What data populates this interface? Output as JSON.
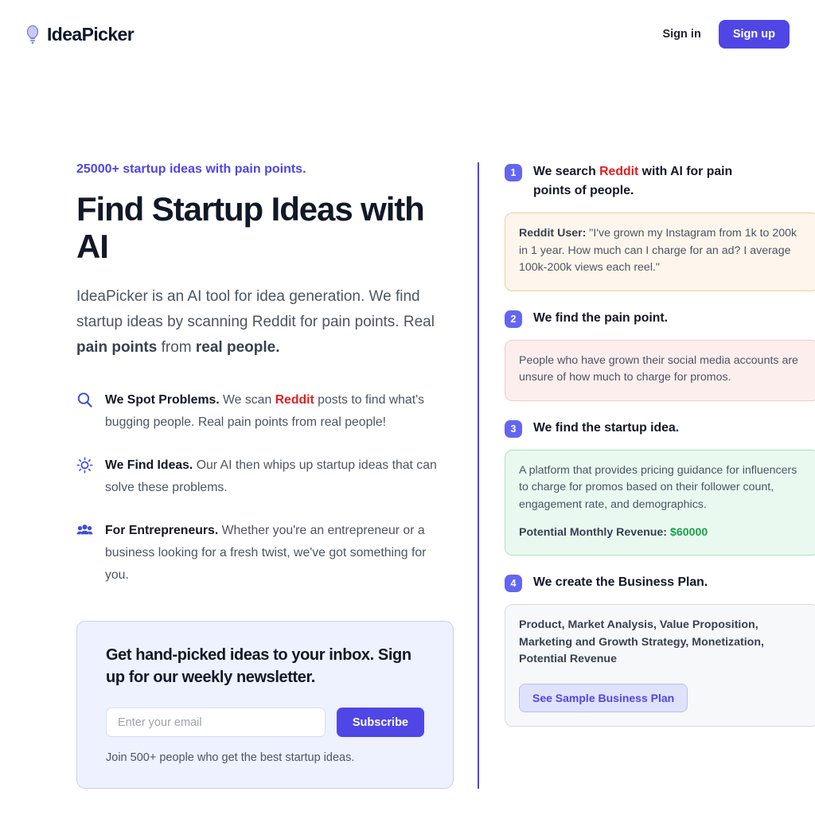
{
  "header": {
    "brand_name": "IdeaPicker",
    "brand_icon": "lightbulb-icon",
    "signin_label": "Sign in",
    "signup_label": "Sign up",
    "accent_color": "#4f46e5"
  },
  "hero": {
    "eyebrow": "25000+ startup ideas with pain points.",
    "title": "Find Startup Ideas with AI",
    "subtitle_part1": "IdeaPicker is an AI tool for idea generation. We find startup ideas by scanning Reddit for pain points. Real ",
    "subtitle_bold1": "pain points",
    "subtitle_part2": " from ",
    "subtitle_bold2": "real people."
  },
  "features": [
    {
      "icon": "search-icon",
      "heading": "We Spot Problems.",
      "body_part1": " We scan ",
      "highlight": "Reddit",
      "body_part2": " posts to find what's bugging people. Real pain points from real people!"
    },
    {
      "icon": "lightbulb-icon",
      "heading": "We Find Ideas.",
      "body_part1": " Our AI then whips up startup ideas that can solve these problems.",
      "highlight": "",
      "body_part2": ""
    },
    {
      "icon": "users-icon",
      "heading": "For Entrepreneurs.",
      "body_part1": " Whether you're an entrepreneur or a business looking for a fresh twist, we've got something for you.",
      "highlight": "",
      "body_part2": ""
    }
  ],
  "newsletter": {
    "title": "Get hand-picked ideas to your inbox. Sign up for our weekly newsletter.",
    "email_placeholder": "Enter your email",
    "email_value": "",
    "subscribe_label": "Subscribe",
    "note": "Join 500+ people who get the best startup ideas."
  },
  "steps": [
    {
      "number": "1",
      "title_part1": "We search ",
      "title_highlight": "Reddit",
      "title_part2": " with AI for pain points of people.",
      "card_style": "card-amber",
      "card_label": "Reddit User:",
      "card_body": " \"I've grown my Instagram from 1k to 200k in 1 year. How much can I charge for an ad? I average 100k-200k views each reel.\""
    },
    {
      "number": "2",
      "title_part1": "We find the pain point.",
      "title_highlight": "",
      "title_part2": "",
      "card_style": "card-rose",
      "card_label": "",
      "card_body": "People who have grown their social media accounts are unsure of how much to charge for promos."
    },
    {
      "number": "3",
      "title_part1": "We find the startup idea.",
      "title_highlight": "",
      "title_part2": "",
      "card_style": "card-green",
      "card_label": "",
      "card_body": "A platform that provides pricing guidance for influencers to charge for promos based on their follower count, engagement rate, and demographics.",
      "revenue_label": "Potential Monthly Revenue:",
      "revenue_value": "$60000"
    },
    {
      "number": "4",
      "title_part1": "We create the Business Plan.",
      "title_highlight": "",
      "title_part2": "",
      "card_style": "card-gray",
      "card_label": "",
      "card_body": "Product, Market Analysis, Value Proposition, Marketing and Growth Strategy, Monetization, Potential Revenue",
      "button_label": "See Sample Business Plan"
    }
  ]
}
